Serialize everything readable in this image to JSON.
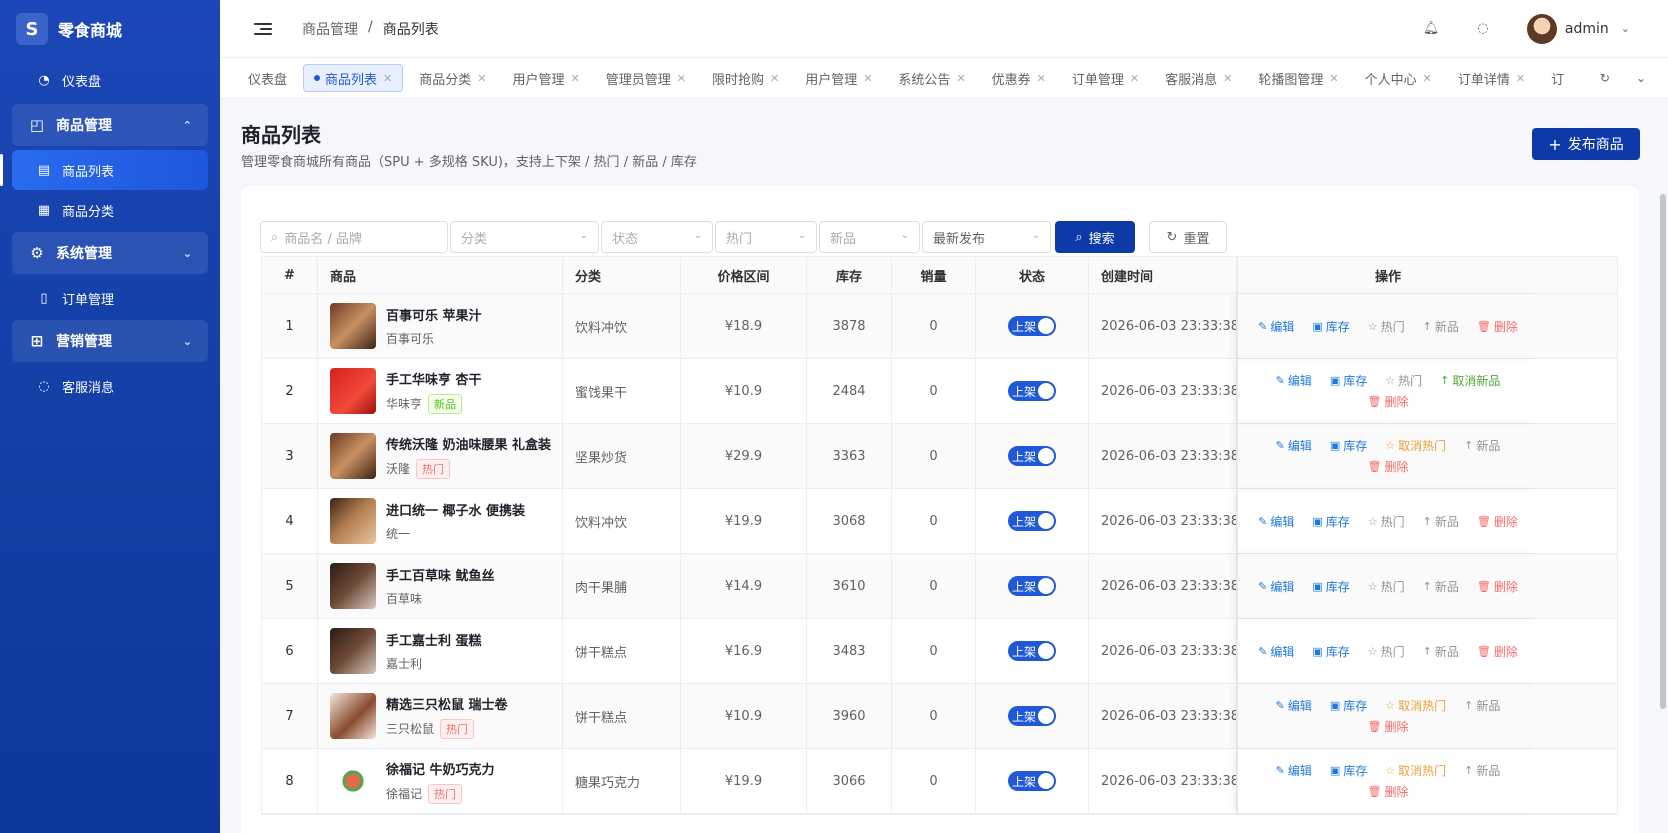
{
  "app": {
    "logo_letter": "S",
    "name": "零食商城"
  },
  "sidebar": {
    "dashboard": "仪表盘",
    "groups": [
      {
        "label": "商品管理",
        "items": [
          "商品列表",
          "商品分类"
        ]
      },
      {
        "label": "系统管理",
        "items": [
          "订单管理"
        ]
      },
      {
        "label": "营销管理",
        "items": [
          "客服消息"
        ]
      }
    ]
  },
  "header": {
    "breadcrumb": [
      "商品管理",
      "商品列表"
    ],
    "user": "admin"
  },
  "tabs": [
    "仪表盘",
    "商品列表",
    "商品分类",
    "用户管理",
    "管理员管理",
    "限时抢购",
    "用户管理",
    "系统公告",
    "优惠券",
    "订单管理",
    "客服消息",
    "轮播图管理",
    "个人中心",
    "订单详情",
    "订"
  ],
  "page": {
    "title": "商品列表",
    "subtitle": "管理零食商城所有商品（SPU + 多规格 SKU)，支持上下架 / 热门 / 新品 / 库存",
    "publish": "发布商品"
  },
  "filters": {
    "search_placeholder": "商品名 / 品牌",
    "category": "分类",
    "status": "状态",
    "hot": "热门",
    "new": "新品",
    "sort": "最新发布",
    "search_btn": "搜索",
    "reset_btn": "重置"
  },
  "table": {
    "headers": [
      "#",
      "商品",
      "分类",
      "价格区间",
      "库存",
      "销量",
      "状态",
      "创建时间",
      "操作"
    ],
    "rows": [
      {
        "idx": "1",
        "name": "百事可乐 苹果汁",
        "brand": "百事可乐",
        "badge": "",
        "category": "饮料冲饮",
        "price": "¥18.9",
        "stock": "3878",
        "sales": "0",
        "status": "上架",
        "time": "2026-06-03 23:33:38",
        "hot": "热门",
        "new": "新品"
      },
      {
        "idx": "2",
        "name": "手工华味亨 杏干",
        "brand": "华味亨",
        "badge": "新品",
        "category": "蜜饯果干",
        "price": "¥10.9",
        "stock": "2484",
        "sales": "0",
        "status": "上架",
        "time": "2026-06-03 23:33:38",
        "hot": "热门",
        "new": "取消新品"
      },
      {
        "idx": "3",
        "name": "传统沃隆 奶油味腰果 礼盒装",
        "brand": "沃隆",
        "badge": "热门",
        "category": "坚果炒货",
        "price": "¥29.9",
        "stock": "3363",
        "sales": "0",
        "status": "上架",
        "time": "2026-06-03 23:33:38",
        "hot": "取消热门",
        "new": "新品"
      },
      {
        "idx": "4",
        "name": "进口统一 椰子水 便携装",
        "brand": "统一",
        "badge": "",
        "category": "饮料冲饮",
        "price": "¥19.9",
        "stock": "3068",
        "sales": "0",
        "status": "上架",
        "time": "2026-06-03 23:33:38",
        "hot": "热门",
        "new": "新品"
      },
      {
        "idx": "5",
        "name": "手工百草味 鱿鱼丝",
        "brand": "百草味",
        "badge": "",
        "category": "肉干果脯",
        "price": "¥14.9",
        "stock": "3610",
        "sales": "0",
        "status": "上架",
        "time": "2026-06-03 23:33:38",
        "hot": "热门",
        "new": "新品"
      },
      {
        "idx": "6",
        "name": "手工嘉士利 蛋糕",
        "brand": "嘉士利",
        "badge": "",
        "category": "饼干糕点",
        "price": "¥16.9",
        "stock": "3483",
        "sales": "0",
        "status": "上架",
        "time": "2026-06-03 23:33:38",
        "hot": "热门",
        "new": "新品"
      },
      {
        "idx": "7",
        "name": "精选三只松鼠 瑞士卷",
        "brand": "三只松鼠",
        "badge": "热门",
        "category": "饼干糕点",
        "price": "¥10.9",
        "stock": "3960",
        "sales": "0",
        "status": "上架",
        "time": "2026-06-03 23:33:38",
        "hot": "取消热门",
        "new": "新品"
      },
      {
        "idx": "8",
        "name": "徐福记 牛奶巧克力",
        "brand": "徐福记",
        "badge": "热门",
        "category": "糖果巧克力",
        "price": "¥19.9",
        "stock": "3066",
        "sales": "0",
        "status": "上架",
        "time": "2026-06-03 23:33:38",
        "hot": "取消热门",
        "new": "新品"
      }
    ],
    "ops": {
      "edit": "编辑",
      "stock": "库存",
      "delete": "删除"
    }
  },
  "colors": {
    "primary": "#0d3aa8",
    "sidebar": "#133fa6",
    "danger": "#f56c6c",
    "warning": "#e6a23c",
    "success": "#52a63a"
  }
}
